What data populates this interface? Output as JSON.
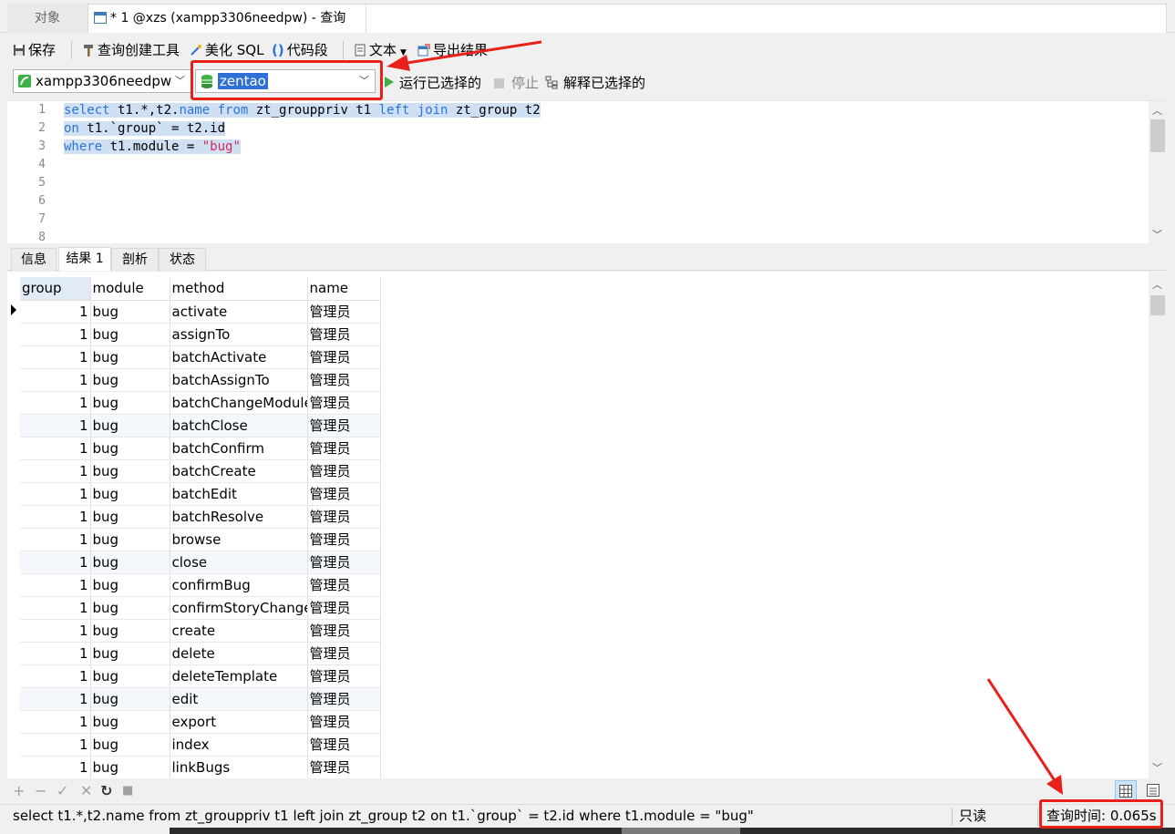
{
  "tabs": {
    "objects": "对象",
    "query": "* 1 @xzs (xampp3306needpw) - 查询"
  },
  "toolbar": {
    "save": "保存",
    "query_builder": "查询创建工具",
    "beautify": "美化 SQL",
    "snippet": "代码段",
    "text": "文本",
    "export": "导出结果"
  },
  "connection": {
    "server": "xampp3306needpw",
    "database": "zentao",
    "run_selected": "运行已选择的",
    "stop": "停止",
    "explain": "解释已选择的"
  },
  "editor": {
    "line_numbers": [
      "1",
      "2",
      "3",
      "4",
      "5",
      "6",
      "7",
      "8"
    ],
    "line1": {
      "a": "select",
      "b": " t1.*,t2.",
      "c": "name",
      "d": " ",
      "e": "from",
      "f": " zt_grouppriv t1 ",
      "g": "left",
      "h": " ",
      "i": "join",
      "j": " zt_group t2"
    },
    "line2": {
      "a": "on",
      "b": " t1.`group` = t2.id"
    },
    "line3": {
      "a": "where",
      "b": " t1.module = ",
      "c": "\"bug\""
    }
  },
  "result_tabs": [
    "信息",
    "结果 1",
    "剖析",
    "状态"
  ],
  "grid": {
    "columns": [
      "group",
      "module",
      "method",
      "name"
    ],
    "rows": [
      [
        "1",
        "bug",
        "activate",
        "管理员"
      ],
      [
        "1",
        "bug",
        "assignTo",
        "管理员"
      ],
      [
        "1",
        "bug",
        "batchActivate",
        "管理员"
      ],
      [
        "1",
        "bug",
        "batchAssignTo",
        "管理员"
      ],
      [
        "1",
        "bug",
        "batchChangeModule",
        "管理员"
      ],
      [
        "1",
        "bug",
        "batchClose",
        "管理员"
      ],
      [
        "1",
        "bug",
        "batchConfirm",
        "管理员"
      ],
      [
        "1",
        "bug",
        "batchCreate",
        "管理员"
      ],
      [
        "1",
        "bug",
        "batchEdit",
        "管理员"
      ],
      [
        "1",
        "bug",
        "batchResolve",
        "管理员"
      ],
      [
        "1",
        "bug",
        "browse",
        "管理员"
      ],
      [
        "1",
        "bug",
        "close",
        "管理员"
      ],
      [
        "1",
        "bug",
        "confirmBug",
        "管理员"
      ],
      [
        "1",
        "bug",
        "confirmStoryChange",
        "管理员"
      ],
      [
        "1",
        "bug",
        "create",
        "管理员"
      ],
      [
        "1",
        "bug",
        "delete",
        "管理员"
      ],
      [
        "1",
        "bug",
        "deleteTemplate",
        "管理员"
      ],
      [
        "1",
        "bug",
        "edit",
        "管理员"
      ],
      [
        "1",
        "bug",
        "export",
        "管理员"
      ],
      [
        "1",
        "bug",
        "index",
        "管理员"
      ],
      [
        "1",
        "bug",
        "linkBugs",
        "管理员"
      ]
    ]
  },
  "grid_controls": [
    "+",
    "−",
    "✓",
    "✕",
    "↻",
    "■"
  ],
  "status": {
    "sql": "select t1.*,t2.name from zt_grouppriv t1 left join zt_group t2 on t1.`group` = t2.id where t1.module = \"bug\"",
    "readonly": "只读",
    "query_time": "查询时间: 0.065s"
  },
  "colors": {
    "accent": "#2f6fd6",
    "keyword": "#2e74d6",
    "string": "#d32a58",
    "annotation": "#e8221a",
    "run": "#3cb043"
  }
}
